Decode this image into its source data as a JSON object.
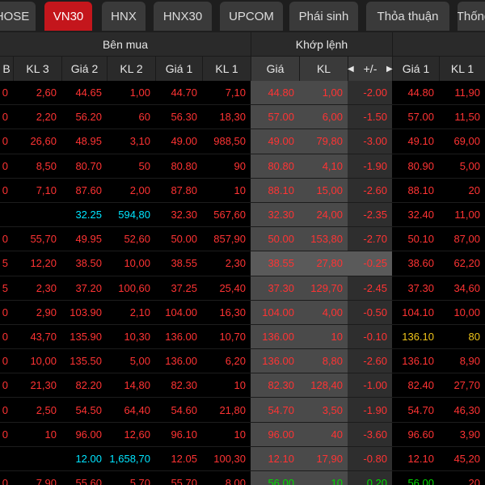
{
  "tabs": [
    {
      "label": "HOSE",
      "active": false
    },
    {
      "label": "VN30",
      "active": true
    },
    {
      "label": "HNX",
      "active": false
    },
    {
      "label": "HNX30",
      "active": false
    },
    {
      "label": "UPCOM",
      "active": false
    },
    {
      "label": "Phái sinh",
      "active": false
    },
    {
      "label": "Thỏa thuận",
      "active": false
    },
    {
      "label": "Thống kê",
      "active": false
    }
  ],
  "header": {
    "buy_group": "Bên mua",
    "match_group": "Khớp lệnh",
    "columns": [
      "B",
      "KL 3",
      "Giá 2",
      "KL 2",
      "Giá 1",
      "KL 1",
      "Giá",
      "KL",
      "+/-",
      "Giá 1",
      "KL 1"
    ]
  },
  "rows": [
    {
      "cells": [
        [
          "0",
          "r"
        ],
        [
          "2,60",
          "r"
        ],
        [
          "44.65",
          "r"
        ],
        [
          "1,00",
          "r"
        ],
        [
          "44.70",
          "r"
        ],
        [
          "7,10",
          "r"
        ],
        [
          "44.80",
          "r"
        ],
        [
          "1,00",
          "r"
        ],
        [
          "-2.00",
          "r"
        ],
        [
          "44.80",
          "r"
        ],
        [
          "11,90",
          "r"
        ]
      ]
    },
    {
      "cells": [
        [
          "0",
          "r"
        ],
        [
          "2,20",
          "r"
        ],
        [
          "56.20",
          "r"
        ],
        [
          "60",
          "r"
        ],
        [
          "56.30",
          "r"
        ],
        [
          "18,30",
          "r"
        ],
        [
          "57.00",
          "r"
        ],
        [
          "6,00",
          "r"
        ],
        [
          "-1.50",
          "r"
        ],
        [
          "57.00",
          "r"
        ],
        [
          "11,50",
          "r"
        ]
      ]
    },
    {
      "cells": [
        [
          "0",
          "r"
        ],
        [
          "26,60",
          "r"
        ],
        [
          "48.95",
          "r"
        ],
        [
          "3,10",
          "r"
        ],
        [
          "49.00",
          "r"
        ],
        [
          "988,50",
          "r"
        ],
        [
          "49.00",
          "r"
        ],
        [
          "79,80",
          "r"
        ],
        [
          "-3.00",
          "r"
        ],
        [
          "49.10",
          "r"
        ],
        [
          "69,00",
          "r"
        ]
      ]
    },
    {
      "cells": [
        [
          "0",
          "r"
        ],
        [
          "8,50",
          "r"
        ],
        [
          "80.70",
          "r"
        ],
        [
          "50",
          "r"
        ],
        [
          "80.80",
          "r"
        ],
        [
          "90",
          "r"
        ],
        [
          "80.80",
          "r"
        ],
        [
          "4,10",
          "r"
        ],
        [
          "-1.90",
          "r"
        ],
        [
          "80.90",
          "r"
        ],
        [
          "5,00",
          "r"
        ]
      ]
    },
    {
      "cells": [
        [
          "0",
          "r"
        ],
        [
          "7,10",
          "r"
        ],
        [
          "87.60",
          "r"
        ],
        [
          "2,00",
          "r"
        ],
        [
          "87.80",
          "r"
        ],
        [
          "10",
          "r"
        ],
        [
          "88.10",
          "r"
        ],
        [
          "15,00",
          "r"
        ],
        [
          "-2.60",
          "r"
        ],
        [
          "88.10",
          "r"
        ],
        [
          "20",
          "r"
        ]
      ]
    },
    {
      "cells": [
        [
          "",
          "r"
        ],
        [
          "",
          "r"
        ],
        [
          "32.25",
          "cy"
        ],
        [
          "594,80",
          "cy"
        ],
        [
          "32.30",
          "r"
        ],
        [
          "567,60",
          "r"
        ],
        [
          "32.30",
          "r"
        ],
        [
          "24,00",
          "r"
        ],
        [
          "-2.35",
          "r"
        ],
        [
          "32.40",
          "r"
        ],
        [
          "11,00",
          "r"
        ]
      ]
    },
    {
      "cells": [
        [
          "0",
          "r"
        ],
        [
          "55,70",
          "r"
        ],
        [
          "49.95",
          "r"
        ],
        [
          "52,60",
          "r"
        ],
        [
          "50.00",
          "r"
        ],
        [
          "857,90",
          "r"
        ],
        [
          "50.00",
          "r"
        ],
        [
          "153,80",
          "r"
        ],
        [
          "-2.70",
          "r"
        ],
        [
          "50.10",
          "r"
        ],
        [
          "87,00",
          "r"
        ]
      ]
    },
    {
      "cells": [
        [
          "5",
          "r"
        ],
        [
          "12,20",
          "r"
        ],
        [
          "38.50",
          "r"
        ],
        [
          "10,00",
          "r"
        ],
        [
          "38.55",
          "r"
        ],
        [
          "2,30",
          "r"
        ],
        [
          "38.55",
          "r"
        ],
        [
          "27,80",
          "r"
        ],
        [
          "-0.25",
          "r"
        ],
        [
          "38.60",
          "r"
        ],
        [
          "62,20",
          "r"
        ]
      ],
      "hl": true
    },
    {
      "cells": [
        [
          "5",
          "r"
        ],
        [
          "2,30",
          "r"
        ],
        [
          "37.20",
          "r"
        ],
        [
          "100,60",
          "r"
        ],
        [
          "37.25",
          "r"
        ],
        [
          "25,40",
          "r"
        ],
        [
          "37.30",
          "r"
        ],
        [
          "129,70",
          "r"
        ],
        [
          "-2.45",
          "r"
        ],
        [
          "37.30",
          "r"
        ],
        [
          "34,60",
          "r"
        ]
      ]
    },
    {
      "cells": [
        [
          "0",
          "r"
        ],
        [
          "2,90",
          "r"
        ],
        [
          "103.90",
          "r"
        ],
        [
          "2,10",
          "r"
        ],
        [
          "104.00",
          "r"
        ],
        [
          "16,30",
          "r"
        ],
        [
          "104.00",
          "r"
        ],
        [
          "4,00",
          "r"
        ],
        [
          "-0.50",
          "r"
        ],
        [
          "104.10",
          "r"
        ],
        [
          "10,00",
          "r"
        ]
      ]
    },
    {
      "cells": [
        [
          "0",
          "r"
        ],
        [
          "43,70",
          "r"
        ],
        [
          "135.90",
          "r"
        ],
        [
          "10,30",
          "r"
        ],
        [
          "136.00",
          "r"
        ],
        [
          "10,70",
          "r"
        ],
        [
          "136.00",
          "r"
        ],
        [
          "10",
          "r"
        ],
        [
          "-0.10",
          "r"
        ],
        [
          "136.10",
          "y"
        ],
        [
          "80",
          "y"
        ]
      ]
    },
    {
      "cells": [
        [
          "0",
          "r"
        ],
        [
          "10,00",
          "r"
        ],
        [
          "135.50",
          "r"
        ],
        [
          "5,00",
          "r"
        ],
        [
          "136.00",
          "r"
        ],
        [
          "6,20",
          "r"
        ],
        [
          "136.00",
          "r"
        ],
        [
          "8,80",
          "r"
        ],
        [
          "-2.60",
          "r"
        ],
        [
          "136.10",
          "r"
        ],
        [
          "8,90",
          "r"
        ]
      ]
    },
    {
      "cells": [
        [
          "0",
          "r"
        ],
        [
          "21,30",
          "r"
        ],
        [
          "82.20",
          "r"
        ],
        [
          "14,80",
          "r"
        ],
        [
          "82.30",
          "r"
        ],
        [
          "10",
          "r"
        ],
        [
          "82.30",
          "r"
        ],
        [
          "128,40",
          "r"
        ],
        [
          "-1.00",
          "r"
        ],
        [
          "82.40",
          "r"
        ],
        [
          "27,70",
          "r"
        ]
      ]
    },
    {
      "cells": [
        [
          "0",
          "r"
        ],
        [
          "2,50",
          "r"
        ],
        [
          "54.50",
          "r"
        ],
        [
          "64,40",
          "r"
        ],
        [
          "54.60",
          "r"
        ],
        [
          "21,80",
          "r"
        ],
        [
          "54.70",
          "r"
        ],
        [
          "3,50",
          "r"
        ],
        [
          "-1.90",
          "r"
        ],
        [
          "54.70",
          "r"
        ],
        [
          "46,30",
          "r"
        ]
      ]
    },
    {
      "cells": [
        [
          "0",
          "r"
        ],
        [
          "10",
          "r"
        ],
        [
          "96.00",
          "r"
        ],
        [
          "12,60",
          "r"
        ],
        [
          "96.10",
          "r"
        ],
        [
          "10",
          "r"
        ],
        [
          "96.00",
          "r"
        ],
        [
          "40",
          "r"
        ],
        [
          "-3.60",
          "r"
        ],
        [
          "96.60",
          "r"
        ],
        [
          "3,90",
          "r"
        ]
      ]
    },
    {
      "cells": [
        [
          "",
          "r"
        ],
        [
          "",
          "r"
        ],
        [
          "12.00",
          "cy"
        ],
        [
          "1,658,70",
          "cy"
        ],
        [
          "12.05",
          "r"
        ],
        [
          "100,30",
          "r"
        ],
        [
          "12.10",
          "r"
        ],
        [
          "17,90",
          "r"
        ],
        [
          "-0.80",
          "r"
        ],
        [
          "12.10",
          "r"
        ],
        [
          "45,20",
          "r"
        ]
      ]
    },
    {
      "cells": [
        [
          "0",
          "r"
        ],
        [
          "7,90",
          "r"
        ],
        [
          "55.60",
          "r"
        ],
        [
          "5,70",
          "r"
        ],
        [
          "55.70",
          "r"
        ],
        [
          "8,00",
          "r"
        ],
        [
          "56.00",
          "g"
        ],
        [
          "10",
          "g"
        ],
        [
          "0.20",
          "g"
        ],
        [
          "56.00",
          "g"
        ],
        [
          "20",
          "r"
        ]
      ]
    }
  ]
}
